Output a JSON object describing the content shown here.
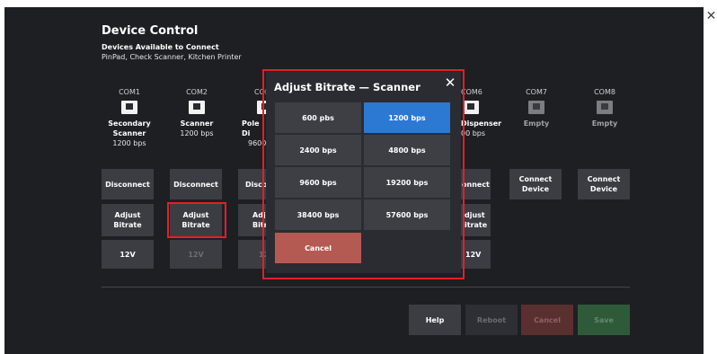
{
  "title": "Device Control",
  "available": {
    "heading": "Devices Available to Connect",
    "list": "PinPad, Check Scanner, Kitchen Printer"
  },
  "ports": [
    {
      "port": "COM1",
      "name1": "Secondary",
      "name2": "Scanner",
      "rate": "1200 bps",
      "action": "Disconnect",
      "adjust1": "Adjust",
      "adjust2": "Bitrate",
      "power": "12V"
    },
    {
      "port": "COM2",
      "name1": "Scanner",
      "rate": "1200 bps",
      "action": "Disconnect",
      "adjust1": "Adjust",
      "adjust2": "Bitrate",
      "power": "12V"
    },
    {
      "port": "COM",
      "name1": "Pole Di",
      "rate": "9600",
      "action": "Disco",
      "adjust1": "Adj",
      "adjust2": "Bitr",
      "power": "12"
    },
    {
      "port": "COM6",
      "name1": "Dispenser",
      "rate": "00 bps",
      "action": "onnect",
      "adjust1": "djust",
      "adjust2": "itrate",
      "power": "12V"
    },
    {
      "port": "COM7",
      "name1": "Empty",
      "action1": "Connect",
      "action2": "Device"
    },
    {
      "port": "COM8",
      "name1": "Empty",
      "action1": "Connect",
      "action2": "Device"
    }
  ],
  "footer": {
    "help": "Help",
    "reboot": "Reboot",
    "cancel": "Cancel",
    "save": "Save"
  },
  "modal": {
    "title": "Adjust Bitrate — Scanner",
    "rates": [
      "600 pbs",
      "1200 bps",
      "2400 bps",
      "4800 bps",
      "9600 bps",
      "19200 bps",
      "38400 bps",
      "57600 bps"
    ],
    "selected": "1200 bps",
    "cancel": "Cancel"
  },
  "colors": {
    "background": "#1e1f23",
    "button": "#3c3d43",
    "selected": "#2b79d3",
    "cancel": "#b55a52",
    "highlight": "#e0202a",
    "save": "#2f5a3a",
    "footer_cancel": "#5a2f2f"
  }
}
